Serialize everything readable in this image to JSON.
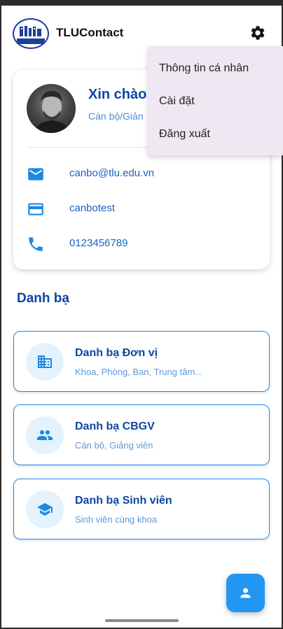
{
  "app": {
    "title": "TLUContact"
  },
  "logo": {
    "text": "TDSP"
  },
  "menu": {
    "items": [
      {
        "label": "Thông tin cá nhân"
      },
      {
        "label": "Cài đặt"
      },
      {
        "label": "Đăng xuất"
      }
    ]
  },
  "profile": {
    "greeting": "Xin chào,",
    "role": "Cán bộ/Giản",
    "email": "canbo@tlu.edu.vn",
    "username": "canbotest",
    "phone": "0123456789"
  },
  "section": {
    "title": "Danh bạ"
  },
  "directories": [
    {
      "title": "Danh bạ Đơn vị",
      "subtitle": "Khoa, Phòng, Ban, Trung tâm...",
      "icon": "building-icon"
    },
    {
      "title": "Danh bạ CBGV",
      "subtitle": "Cán bộ, Giảng viên",
      "icon": "people-icon"
    },
    {
      "title": "Danh bạ Sinh viên",
      "subtitle": "Sinh viên cùng khoa",
      "icon": "graduation-cap-icon"
    }
  ],
  "colors": {
    "primary": "#0d47a1",
    "accent": "#2196f3",
    "menu_bg": "#efe8f3"
  }
}
